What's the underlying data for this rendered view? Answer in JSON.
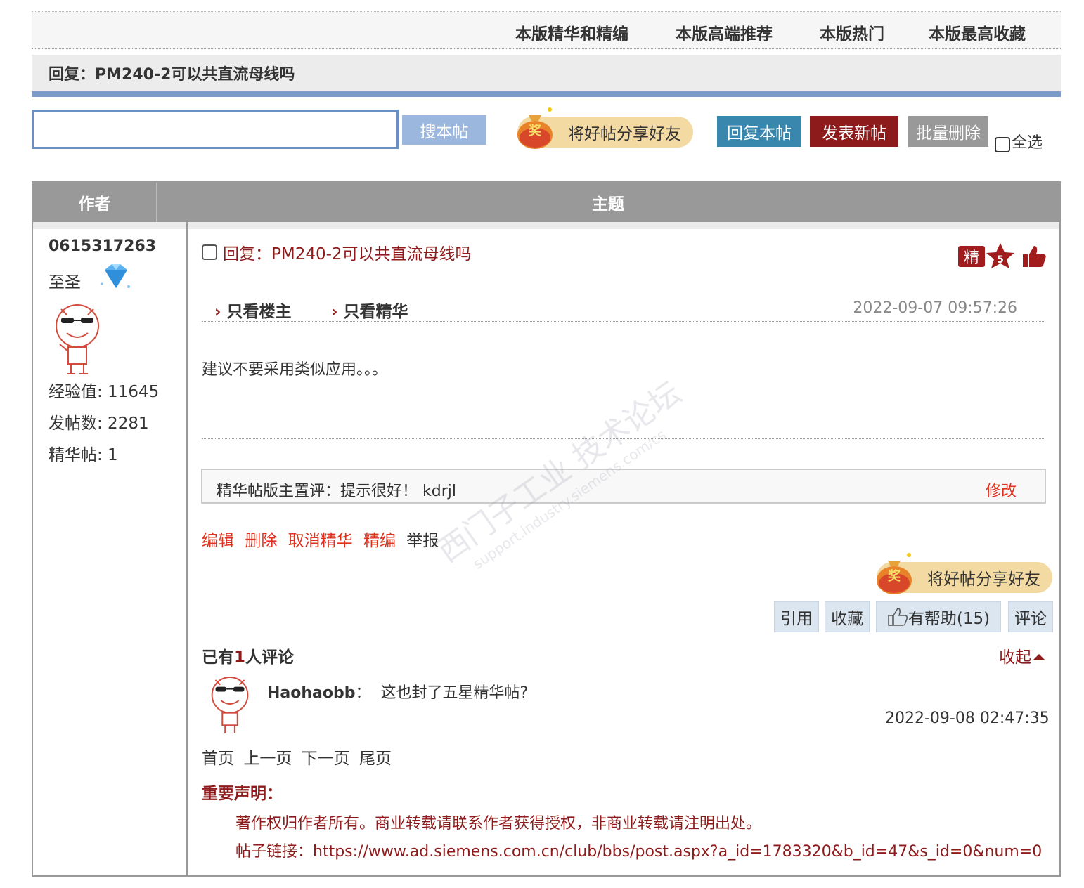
{
  "top_nav": {
    "items": [
      "本版精华和精编",
      "本版高端推荐",
      "本版热门",
      "本版最高收藏"
    ]
  },
  "thread_title": "回复：PM240-2可以共直流母线吗",
  "toolbar": {
    "search_button": "搜本帖",
    "share_label": "将好帖分享好友",
    "share_badge": "奖",
    "reply_button": "回复本帖",
    "new_post_button": "发表新帖",
    "batch_delete_button": "批量删除",
    "select_all_label": "全选"
  },
  "table_header": {
    "author": "作者",
    "subject": "主题"
  },
  "author": {
    "name": "0615317263",
    "rank": "至圣",
    "rank_icon": "diamond-icon",
    "experience": "经验值: 11645",
    "post_count": "发帖数: 2281",
    "featured_count": "精华帖: 1"
  },
  "post": {
    "title": "回复：PM240-2可以共直流母线吗",
    "badge_jing": "精",
    "badge_star_num": "5",
    "filter_author_only": "只看楼主",
    "filter_featured_only": "只看精华",
    "date": "2022-09-07 09:57:26",
    "content": "建议不要采用类似应用。。。",
    "moderator_comment": "精华帖版主置评：提示很好！ kdrjl",
    "moderator_edit": "修改",
    "actions": {
      "edit": "编辑",
      "delete": "删除",
      "unfeature": "取消精华",
      "curate": "精编",
      "report": "举报"
    },
    "share_label": "将好帖分享好友",
    "buttons": {
      "quote": "引用",
      "favorite": "收藏",
      "helpful": "有帮助(15)",
      "comment": "评论"
    }
  },
  "reviews": {
    "prefix": "已有",
    "count": "1",
    "suffix": "人评论",
    "collapse": "收起",
    "items": [
      {
        "user": "Haohaobb",
        "text": "这也封了五星精华帖?",
        "date": "2022-09-08 02:47:35"
      }
    ]
  },
  "pager": [
    "首页",
    "上一页",
    "下一页",
    "尾页"
  ],
  "notice": {
    "title": "重要声明：",
    "copyright": "著作权归作者所有。商业转载请联系作者获得授权，非商业转载请注明出处。",
    "link": "帖子链接：https://www.ad.siemens.com.cn/club/bbs/post.aspx?a_id=1783320&b_id=47&s_id=0&num=0"
  },
  "watermark": {
    "line1": "西门子工业 技术论坛",
    "line2": "support.industry.siemens.com/cs"
  },
  "colors": {
    "brand_red": "#8e1b1b",
    "action_red": "#e0301e",
    "reply_blue": "#3a87ad",
    "header_gray": "#999999",
    "search_border": "#6a8fc4"
  }
}
